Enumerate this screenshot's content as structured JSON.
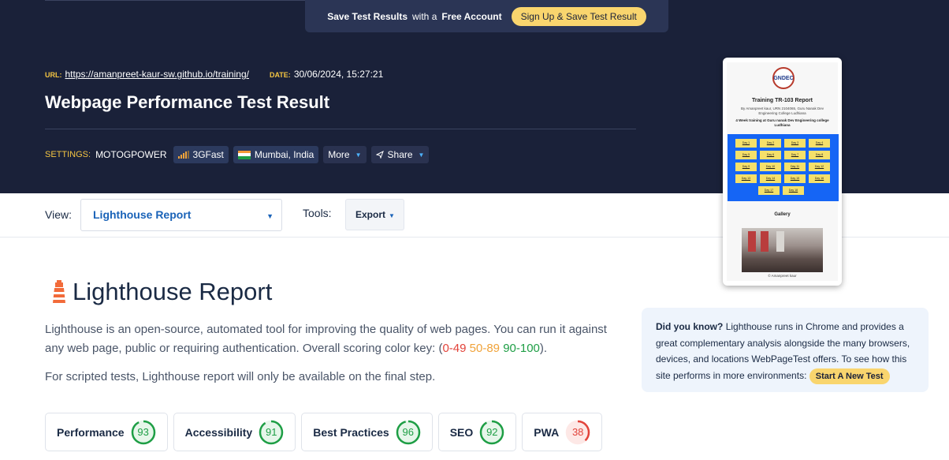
{
  "promo": {
    "bold1": "Save Test Results",
    "with": "with a",
    "bold2": "Free Account",
    "button": "Sign Up & Save Test Result"
  },
  "meta": {
    "url_label": "URL:",
    "url": "https://amanpreet-kaur-sw.github.io/training/",
    "date_label": "DATE:",
    "date": "30/06/2024, 15:27:21"
  },
  "title": "Webpage Performance Test Result",
  "settings": {
    "label": "SETTINGS:",
    "device": "MOTOGPOWER",
    "connection": "3GFast",
    "location": "Mumbai, India",
    "more": "More",
    "share": "Share"
  },
  "toolbar": {
    "view_label": "View:",
    "view_value": "Lighthouse Report",
    "tools_label": "Tools:",
    "export": "Export"
  },
  "thumbnail": {
    "heading": "Training TR-103 Report",
    "sub": "By Amanpreet kaur, URN 2104065, Guru Nanak Dev Engineering College Ludhiana",
    "sub2": "4 Week training at Guru nanak Dev Engineering college Ludhiana",
    "days": [
      "Day 1",
      "Day 2",
      "Day 3",
      "Day 4",
      "Day 5",
      "Day 6",
      "Day 7",
      "Day 8",
      "Day 9",
      "Day 10",
      "Day 11",
      "Day 12",
      "Day 13",
      "Day 14",
      "Day 15",
      "Day 16",
      "Day 17",
      "Day 18"
    ],
    "gallery": "Gallery",
    "footer": "© Amanpreet kaur"
  },
  "report": {
    "title": "Lighthouse Report",
    "desc_pre": "Lighthouse is an open-source, automated tool for improving the quality of web pages. You can run it against any web page, public or requiring authentication. Overall scoring color key: (",
    "key_red": "0-49",
    "key_orange": "50-89",
    "key_green": "90-100",
    "desc_post": ").",
    "scripted_note": "For scripted tests, Lighthouse report will only be available on the final step."
  },
  "did_you_know": {
    "bold": "Did you know?",
    "text": "Lighthouse runs in Chrome and provides a great complementary analysis alongside the many browsers, devices, and locations WebPageTest offers. To see how this site performs in more environments:",
    "button": "Start A New Test"
  },
  "scores": [
    {
      "label": "Performance",
      "value": 93,
      "color": "#1e9e45"
    },
    {
      "label": "Accessibility",
      "value": 91,
      "color": "#1e9e45"
    },
    {
      "label": "Best Practices",
      "value": 96,
      "color": "#1e9e45"
    },
    {
      "label": "SEO",
      "value": 92,
      "color": "#1e9e45"
    },
    {
      "label": "PWA",
      "value": 38,
      "color": "#e2433a"
    }
  ],
  "colors": {
    "hero_bg": "#1a2139",
    "accent_yellow": "#f9d56e",
    "link_blue": "#1a63b8"
  }
}
